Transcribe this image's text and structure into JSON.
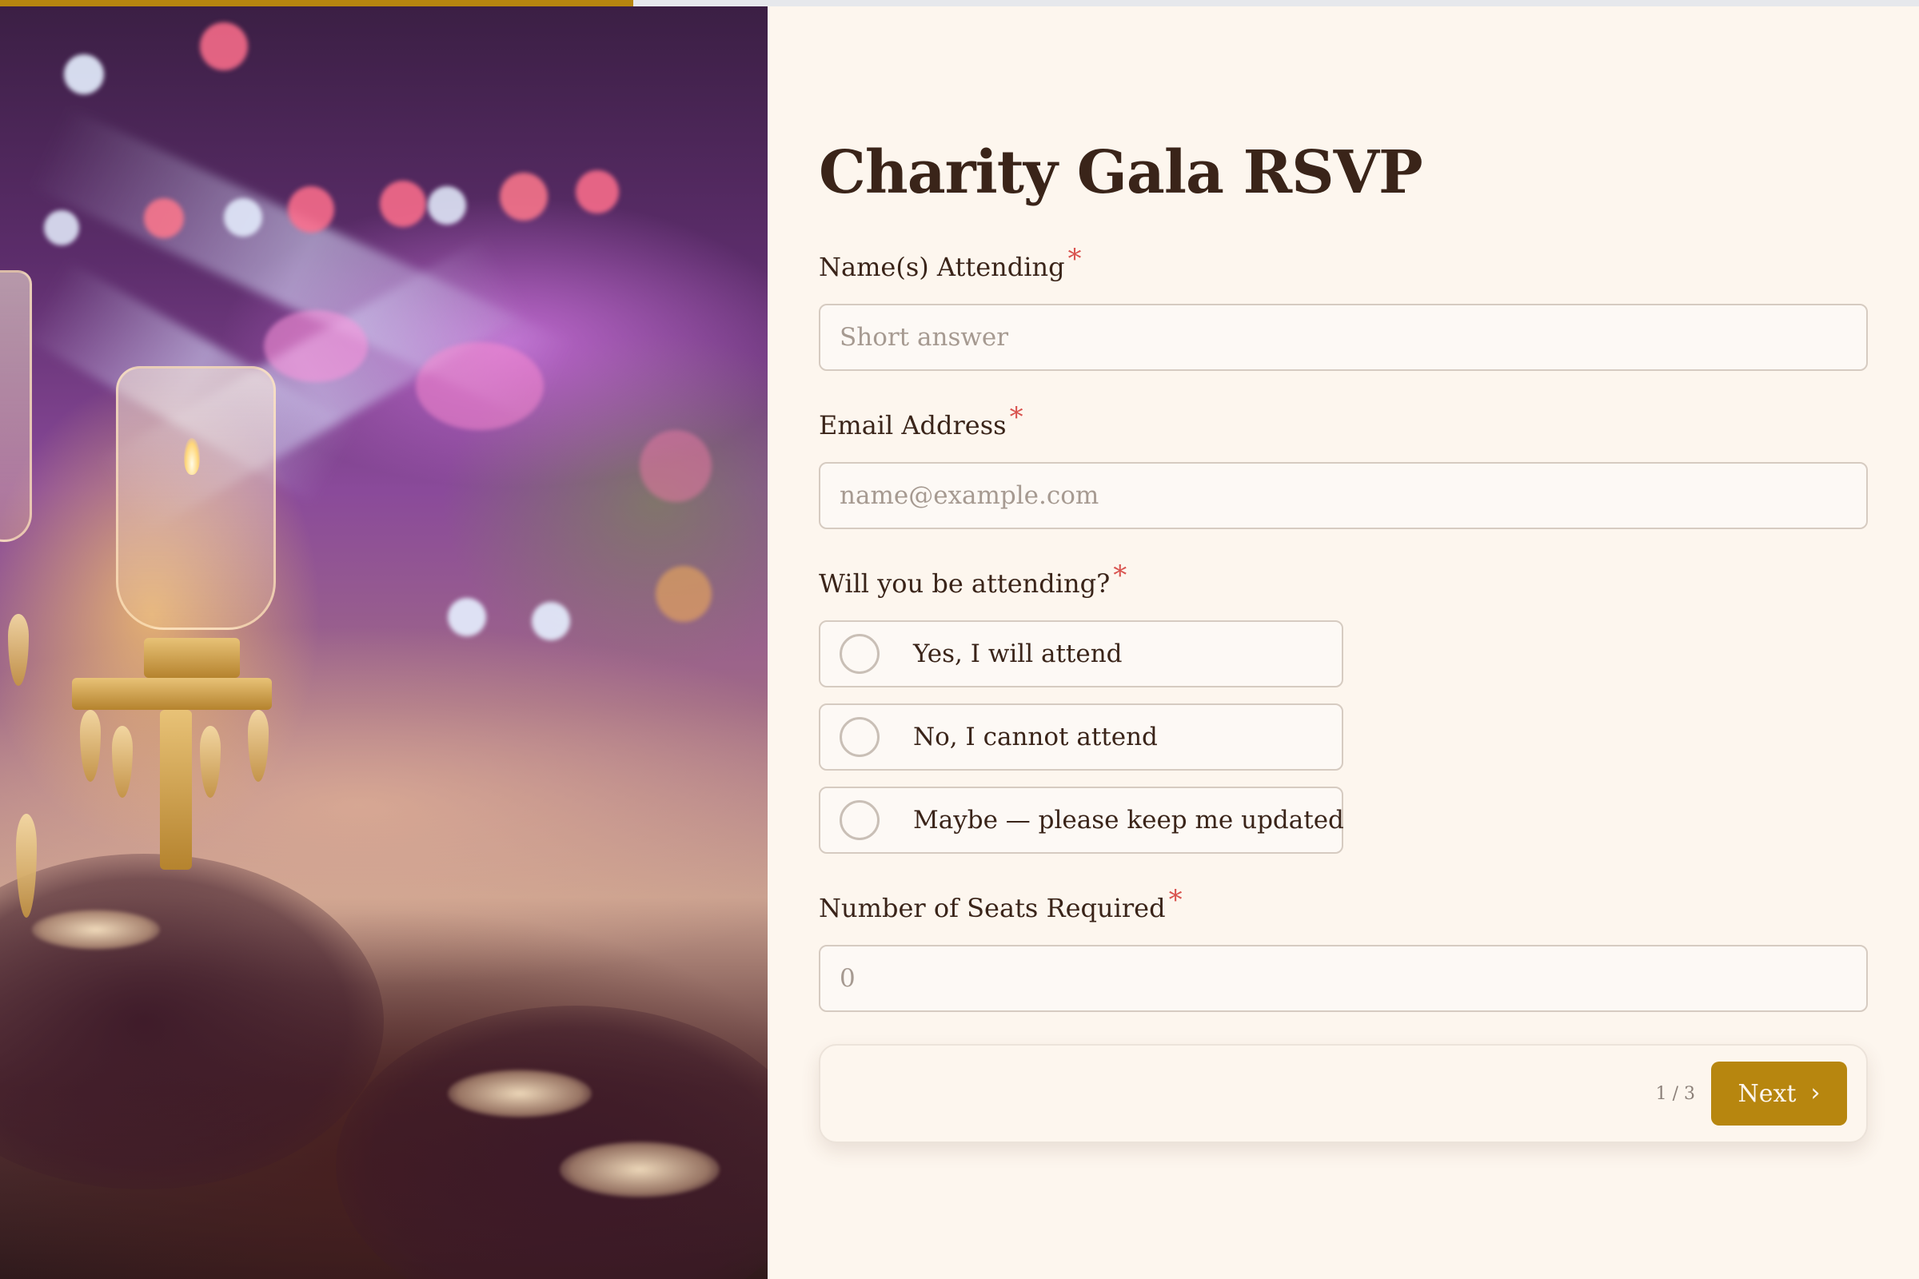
{
  "progress": {
    "step": 1,
    "total_steps": 3,
    "fraction": 0.33
  },
  "form": {
    "title": "Charity Gala RSVP",
    "fields": {
      "names": {
        "label": "Name(s) Attending",
        "required_mark": "*",
        "placeholder": "Short answer",
        "value": ""
      },
      "email": {
        "label": "Email Address",
        "required_mark": "*",
        "placeholder": "name@example.com",
        "value": ""
      },
      "attending": {
        "label": "Will you be attending?",
        "required_mark": "*",
        "options": [
          "Yes, I will attend",
          "No, I cannot attend",
          "Maybe — please keep me updated"
        ]
      },
      "seats": {
        "label": "Number of Seats Required",
        "required_mark": "*",
        "placeholder": "0",
        "value": ""
      }
    },
    "navigation": {
      "page_indicator": "1 / 3",
      "next_label": "Next",
      "next_icon": "chevron-right-icon"
    }
  },
  "colors": {
    "accent": "#b7860f",
    "background": "#fdf6ee",
    "text": "#3a2419",
    "required": "#d9534f",
    "border": "#d6cbc1"
  }
}
